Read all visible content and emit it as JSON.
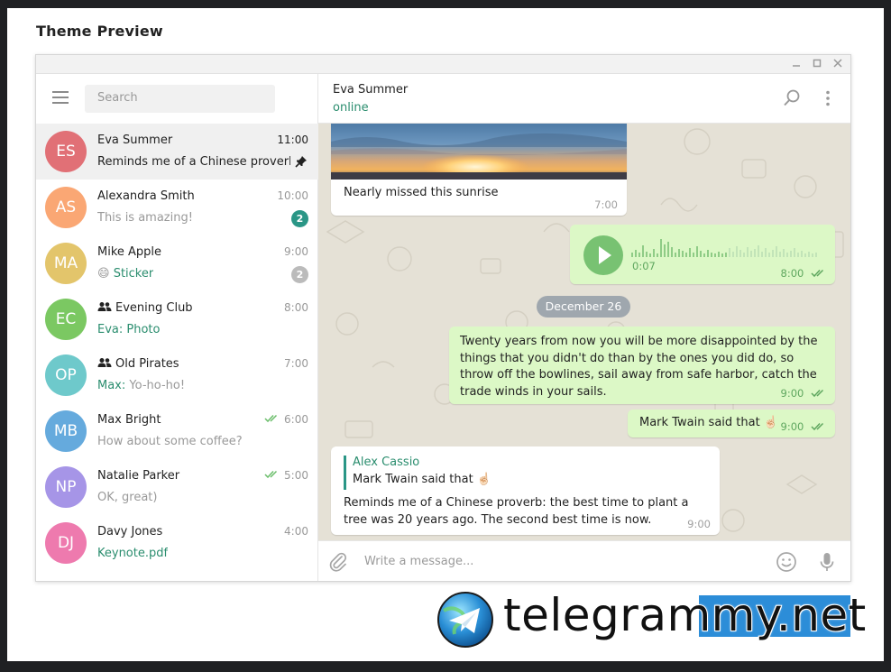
{
  "dialog": {
    "title": "Theme Preview"
  },
  "window_controls": [
    "minimize",
    "maximize",
    "close"
  ],
  "search": {
    "placeholder": "Search"
  },
  "chats": [
    {
      "initials": "ES",
      "name": "Eva Summer",
      "time": "11:00",
      "preview": "Reminds me of a Chinese proverb...",
      "avatar_color": "#e17076",
      "pinned": true,
      "active": true
    },
    {
      "initials": "AS",
      "name": "Alexandra Smith",
      "time": "10:00",
      "preview": "This is amazing!",
      "avatar_color": "#faa774",
      "badge": "2",
      "badge_color": "#2a9686"
    },
    {
      "initials": "MA",
      "name": "Mike Apple",
      "time": "9:00",
      "preview_emoji": "😄",
      "preview": "Sticker",
      "avatar_color": "#e3c56b",
      "badge": "2",
      "badge_color": "#bbbbbb"
    },
    {
      "initials": "EC",
      "name": "Evening Club",
      "time": "8:00",
      "preview": "Eva: Photo",
      "avatar_color": "#7bc862",
      "group": true
    },
    {
      "initials": "OP",
      "name": "Old Pirates",
      "time": "7:00",
      "preview_sender": "Max:",
      "preview": "Yo-ho-ho!",
      "avatar_color": "#6ec9cb",
      "group": true
    },
    {
      "initials": "MB",
      "name": "Max Bright",
      "time": "6:00",
      "preview": "How about some coffee?",
      "avatar_color": "#65aadd",
      "read": true
    },
    {
      "initials": "NP",
      "name": "Natalie Parker",
      "time": "5:00",
      "preview": "OK, great)",
      "avatar_color": "#a695e7",
      "read": true
    },
    {
      "initials": "DJ",
      "name": "Davy Jones",
      "time": "4:00",
      "preview": "Keynote.pdf",
      "avatar_color": "#ee7aae"
    }
  ],
  "conversation": {
    "peer_name": "Eva Summer",
    "peer_status": "online",
    "messages": {
      "photo_caption": "Nearly missed this sunrise",
      "photo_time": "7:00",
      "voice_duration": "0:07",
      "voice_time": "8:00",
      "date_separator": "December 26",
      "quote_text": "Twenty years from now you will be more disappointed by the things that you didn't do than by the ones you did do, so throw off the bowlines, sail away from safe harbor, catch the trade winds in your sails.",
      "quote_time": "9:00",
      "twain_text": "Mark Twain said that ☝🏻",
      "twain_time": "9:00",
      "reply_author": "Alex Cassio",
      "reply_quote": "Mark Twain said that ☝🏻",
      "reply_text": "Reminds me of a Chinese proverb: the best time to plant a tree was 20 years ago. The second best time is now.",
      "reply_time": "9:00"
    },
    "input_placeholder": "Write a message..."
  },
  "colors": {
    "accent_green": "#2a8d6e",
    "outgoing_bubble": "#dcf8c6",
    "incoming_bubble": "#ffffff",
    "chat_background": "#e5e1d6",
    "voice_play": "#78c272"
  },
  "watermark": {
    "text": "telegrammy.net"
  }
}
